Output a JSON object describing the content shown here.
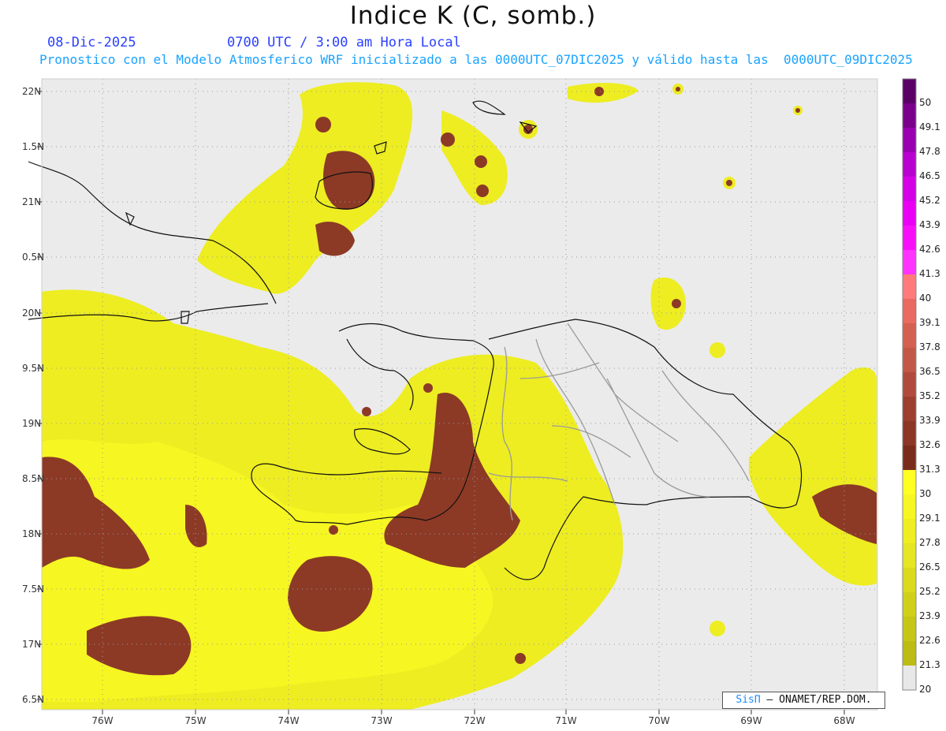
{
  "title": "Indice K (C, somb.)",
  "date_label": "08-Dic-2025",
  "time_label": "0700 UTC / 3:00 am Hora Local",
  "description": "Pronostico con el Modelo Atmosferico WRF inicializado a las 0000UTC_07DIC2025 y válido hasta las  0000UTC_09DIC2025",
  "credit": {
    "logo": "SisΠ",
    "text": "– ONAMET/REP.DOM."
  },
  "lat_labels": [
    "22N",
    "1.5N",
    "21N",
    "0.5N",
    "20N",
    "9.5N",
    "19N",
    "8.5N",
    "18N",
    "7.5N",
    "17N",
    "6.5N"
  ],
  "lon_labels": [
    "76W",
    "75W",
    "74W",
    "73W",
    "72W",
    "71W",
    "70W",
    "69W",
    "68W"
  ],
  "colorbar": {
    "levels": [
      "50",
      "49.1",
      "47.8",
      "46.5",
      "45.2",
      "43.9",
      "42.6",
      "41.3",
      "40",
      "39.1",
      "37.8",
      "36.5",
      "35.2",
      "33.9",
      "32.6",
      "31.3",
      "30",
      "29.1",
      "27.8",
      "26.5",
      "25.2",
      "23.9",
      "22.6",
      "21.3",
      "20"
    ],
    "colors": [
      "#5a0066",
      "#7a008c",
      "#9a00b0",
      "#b800cf",
      "#d400e6",
      "#e900f4",
      "#f710f7",
      "#ff33ff",
      "#ff7a7a",
      "#e86a60",
      "#d46050",
      "#c25848",
      "#b04a3c",
      "#9c3e30",
      "#8c3626",
      "#7a2c1c",
      "#ffff22",
      "#f6f622",
      "#eeee22",
      "#e6e622",
      "#dada1e",
      "#d0d01a",
      "#c6c618",
      "#bcbc14",
      "#e8e8e8"
    ]
  },
  "colors": {
    "background": "#e8e8e8",
    "ocean_gray": "#ebebeb",
    "high_k": "#8c3a26",
    "mid_k": "#f0f028",
    "low_k": "#caca1e"
  }
}
